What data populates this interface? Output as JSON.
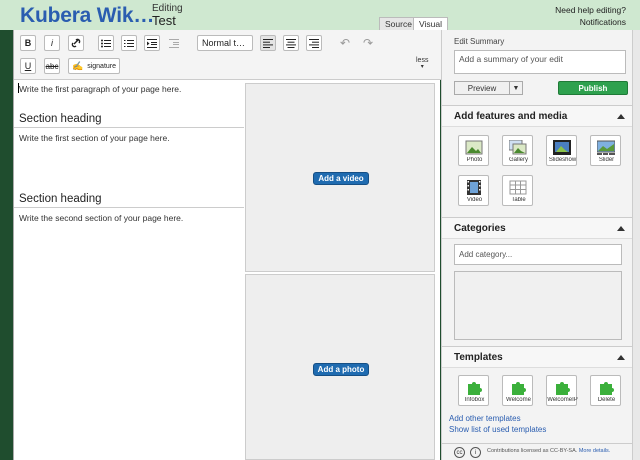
{
  "header": {
    "wiki_title": "Kubera Wik…",
    "editing_label": "Editing",
    "page_name": "Test",
    "help_link": "Need help editing?",
    "notifications_link": "Notifications"
  },
  "tabs": [
    {
      "label": "Source",
      "active": false
    },
    {
      "label": "Visual",
      "active": true
    }
  ],
  "toolbar": {
    "bold": "B",
    "italic": "i",
    "format_select": "Normal t…",
    "underline": "U",
    "strike": "abc",
    "signature": "signature",
    "less": "less"
  },
  "content": {
    "para1": "Write the first paragraph of your page here.",
    "heading1": "Section heading",
    "para2": "Write the first section of your page here.",
    "heading2": "Section heading",
    "para3": "Write the second section of your page here."
  },
  "placeholders": {
    "video_button": "Add a video",
    "photo_button": "Add a photo"
  },
  "rail": {
    "summary_label": "Edit Summary",
    "summary_placeholder": "Add a summary of your edit",
    "preview_button": "Preview",
    "publish_button": "Publish",
    "features_title": "Add features and media",
    "features": [
      {
        "label": "Photo",
        "icon": "photo-icon"
      },
      {
        "label": "Gallery",
        "icon": "gallery-icon"
      },
      {
        "label": "Slideshow",
        "icon": "slideshow-icon"
      },
      {
        "label": "Slider",
        "icon": "slider-icon"
      },
      {
        "label": "Video",
        "icon": "video-icon"
      },
      {
        "label": "Table",
        "icon": "table-icon"
      }
    ],
    "categories_title": "Categories",
    "category_placeholder": "Add category...",
    "templates_title": "Templates",
    "templates": [
      {
        "label": "Infobox"
      },
      {
        "label": "Welcome"
      },
      {
        "label": "WelcomeIP"
      },
      {
        "label": "Delete"
      }
    ],
    "add_templates_link": "Add other templates",
    "used_templates_link": "Show list of used templates",
    "license_text": "Contributions licensed as CC-BY-SA.",
    "license_link": "More details."
  },
  "colors": {
    "background": "#1f4d2e",
    "header": "#cfe8d0",
    "title": "#2a5db0",
    "publish": "#2ea14e",
    "action_button": "#1f6bb0"
  }
}
